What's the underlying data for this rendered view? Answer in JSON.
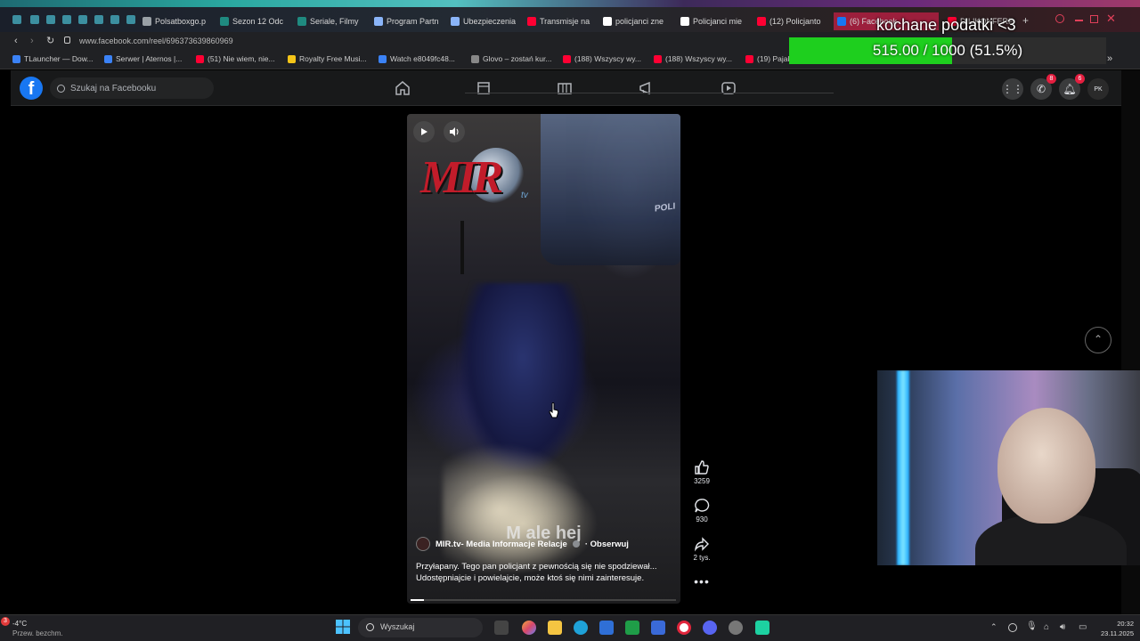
{
  "browser": {
    "tabs": [
      {
        "label": "Polsatboxgo.p",
        "color": "#9aa0a6"
      },
      {
        "label": "Sezon 12 Odc",
        "color": "#1f8a80"
      },
      {
        "label": "Seriale, Filmy",
        "color": "#1f8a80"
      },
      {
        "label": "Program Partn",
        "color": "#8ab4f8"
      },
      {
        "label": "Ubezpieczenia",
        "color": "#8ab4f8"
      },
      {
        "label": "Transmisje na",
        "color": "#ff0033"
      },
      {
        "label": "policjanci zne",
        "color": "#ffffff"
      },
      {
        "label": "Policjanci mie",
        "color": "#ffffff"
      },
      {
        "label": "(12) Policjanto",
        "color": "#ff0033"
      },
      {
        "label": "(6) Facebook",
        "color": "#1877f2"
      },
      {
        "label": "DILIKONFERF",
        "color": "#ff0033"
      }
    ],
    "url": "www.facebook.com/reel/696373639860969",
    "bookmarks": [
      {
        "label": "TLauncher — Dow...",
        "color": "#3b82f6"
      },
      {
        "label": "Serwer | Aternos |...",
        "color": "#3b82f6"
      },
      {
        "label": "(51) Nie wiem, nie...",
        "color": "#ff0033"
      },
      {
        "label": "Royalty Free Musi...",
        "color": "#f5c518"
      },
      {
        "label": "Watch e8049fc48...",
        "color": "#3b82f6"
      },
      {
        "label": "Glovo – zostań kur...",
        "color": "#888888"
      },
      {
        "label": "(188) Wszyscy wy...",
        "color": "#ff0033"
      },
      {
        "label": "(188) Wszyscy wy...",
        "color": "#ff0033"
      },
      {
        "label": "(19) Pajak...",
        "color": "#ff0033"
      }
    ]
  },
  "facebook": {
    "search_placeholder": "Szukaj na Facebooku",
    "messenger_badge": "8",
    "notifications_badge": "6",
    "avatar_initials": "PK"
  },
  "reel": {
    "author": "MIR.tv- Media Informacje Relacje",
    "follow_label": "· Obserwuj",
    "caption_line1": "Przyłapany. Tego pan policjant z pewnością się nie spodziewał...",
    "caption_line2": "Udostępniajcie i powielajcie, może ktoś się nimi zainteresuje.",
    "subtitle": "M ale hej",
    "logo_text": "MIR",
    "logo_suffix": "tv",
    "car_text": "POLI",
    "likes": "3259",
    "comments": "930",
    "shares": "2 tys.",
    "progress": 0.05
  },
  "overlay": {
    "donation_title": "kochane podatki <3",
    "donation_text": "515.00 / 1000 (51.5%)",
    "donation_progress": 0.515,
    "donation_color": "#1ecf1e"
  },
  "taskbar": {
    "weather_temp": "-4°C",
    "weather_desc": "Przew. bezchm.",
    "weather_badge": "3",
    "search_label": "Wyszukaj",
    "time": "20:32",
    "date": "23.11.2025"
  }
}
